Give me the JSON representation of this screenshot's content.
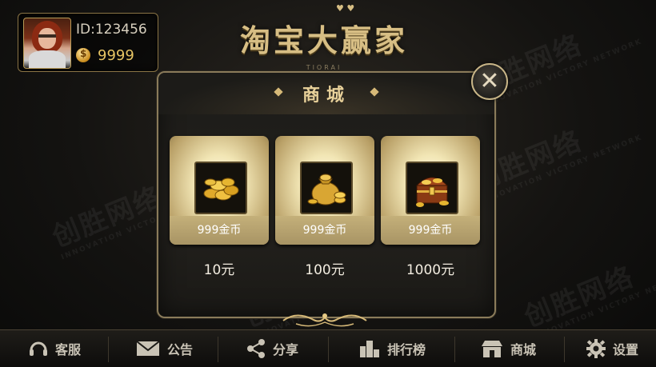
{
  "profile": {
    "id": "ID:123456",
    "coins": "9999"
  },
  "header": {
    "title": "淘宝大赢家",
    "subtitle": "TIORAI"
  },
  "watermark": {
    "brand": "创胜网络",
    "tagline": "INNOVATION VICTORY NETWORK"
  },
  "shop": {
    "title": "商城",
    "items": [
      {
        "label": "999金币",
        "price": "10元",
        "icon": "coin-pile-icon"
      },
      {
        "label": "999金币",
        "price": "100元",
        "icon": "money-bag-icon"
      },
      {
        "label": "999金币",
        "price": "1000元",
        "icon": "treasure-chest-icon"
      }
    ]
  },
  "nav": [
    {
      "label": "客服",
      "icon": "headset-icon"
    },
    {
      "label": "公告",
      "icon": "envelope-icon"
    },
    {
      "label": "分享",
      "icon": "share-icon"
    },
    {
      "label": "排行榜",
      "icon": "ranking-icon"
    },
    {
      "label": "商城",
      "icon": "shop-icon"
    },
    {
      "label": "设置",
      "icon": "gear-icon"
    }
  ],
  "colors": {
    "accent": "#d7be84",
    "gold": "#e7c564"
  }
}
